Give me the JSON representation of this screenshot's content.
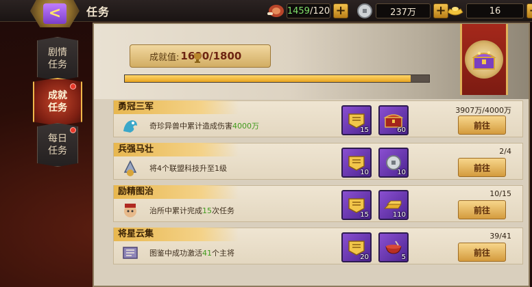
{
  "header": {
    "title": "任务",
    "back_icon": "back-arrow-icon"
  },
  "resources": {
    "stamina": {
      "current": "1459",
      "max": "/120",
      "icon": "meat-icon"
    },
    "silver": {
      "value": "237万",
      "icon": "silver-coin-icon"
    },
    "gold": {
      "value": "16",
      "icon": "gold-ingot-icon"
    }
  },
  "sidebar": {
    "tabs": [
      {
        "label_1": "剧情",
        "label_2": "任务",
        "active": false,
        "badge": false
      },
      {
        "label_1": "成就",
        "label_2": "任务",
        "active": true,
        "badge": true
      },
      {
        "label_1": "每日",
        "label_2": "任务",
        "active": false,
        "badge": true
      }
    ]
  },
  "achievement": {
    "label": "成就值:",
    "value": "1690/1800",
    "progress": 0.939,
    "chest_icon": "treasure-chest-icon"
  },
  "tasks": [
    {
      "title": "勇冠三军",
      "desc_pre": "奇珍异兽中累计造成伤害",
      "desc_hl": "4000万",
      "desc_post": "",
      "icon": "beast-icon",
      "progress": "3907万/4000万",
      "button": "前往",
      "rewards": [
        {
          "icon": "gold-badge-icon",
          "qty": "15"
        },
        {
          "icon": "red-chest-icon",
          "qty": "60"
        }
      ]
    },
    {
      "title": "兵强马壮",
      "desc_pre": "将4个联盟科技升至1级",
      "desc_hl": "",
      "desc_post": "",
      "icon": "alliance-tech-icon",
      "progress": "2/4",
      "button": "前往",
      "rewards": [
        {
          "icon": "gold-badge-icon",
          "qty": "10"
        },
        {
          "icon": "silver-coin-icon",
          "qty": "10"
        }
      ]
    },
    {
      "title": "励精图治",
      "desc_pre": "治所中累计完成",
      "desc_hl": "15",
      "desc_post": "次任务",
      "icon": "official-icon",
      "progress": "10/15",
      "button": "前往",
      "rewards": [
        {
          "icon": "gold-badge-icon",
          "qty": "15"
        },
        {
          "icon": "gold-bars-icon",
          "qty": "110"
        }
      ]
    },
    {
      "title": "将星云集",
      "desc_pre": "图鉴中成功激活",
      "desc_hl": "41",
      "desc_post": "个主将",
      "icon": "scroll-book-icon",
      "progress": "39/41",
      "button": "前往",
      "rewards": [
        {
          "icon": "gold-badge-icon",
          "qty": "20"
        },
        {
          "icon": "red-bowl-icon",
          "qty": "5"
        }
      ]
    }
  ]
}
